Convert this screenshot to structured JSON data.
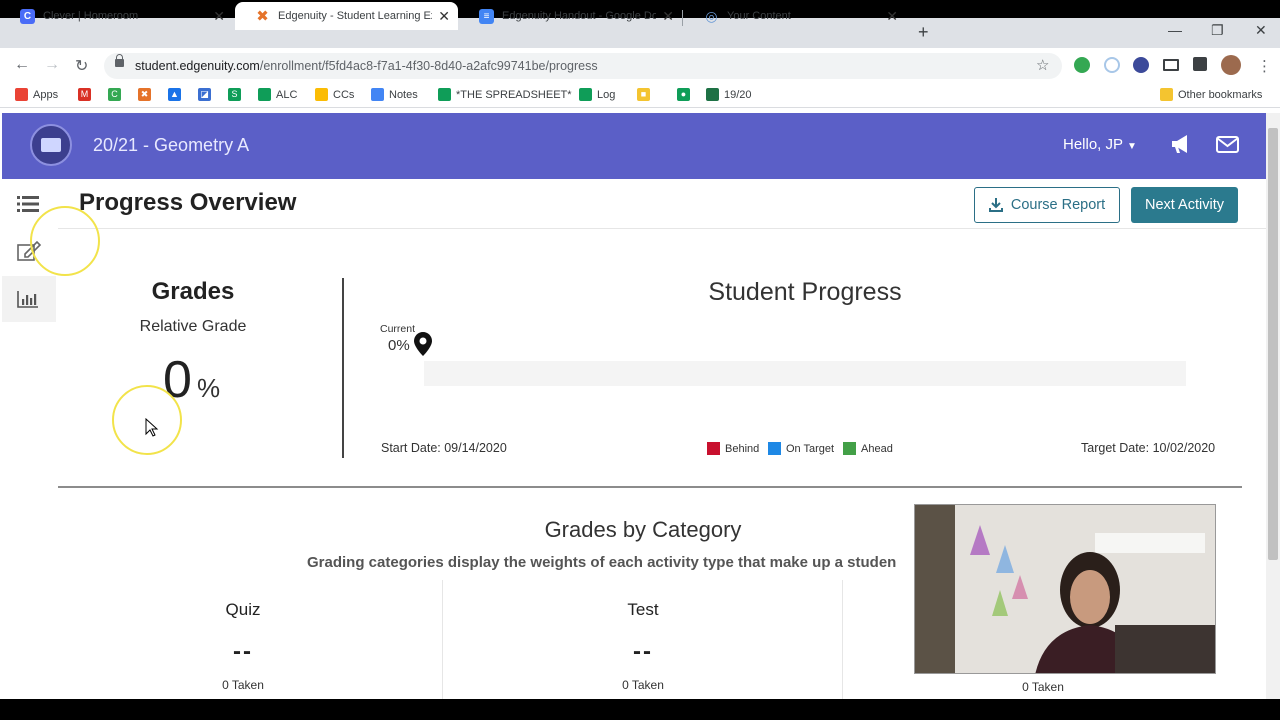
{
  "browser": {
    "tabs": [
      {
        "title": "Clever | Homeroom",
        "favicon_color": "#4a6cf7",
        "favicon_glyph": "C"
      },
      {
        "title": "Edgenuity - Student Learning Exp",
        "favicon_color": "#e5732a",
        "favicon_glyph": "✖"
      },
      {
        "title": "Edgenuity Handout - Google Do",
        "favicon_color": "#4285f4",
        "favicon_glyph": "≡"
      },
      {
        "title": "Your Content",
        "favicon_color": "#9fb8d9",
        "favicon_glyph": "◎"
      }
    ],
    "new_tab_label": "+",
    "close_glyph": "✕",
    "url_host": "student.edgenuity.com",
    "url_path": "/enrollment/f5fd4ac8-f7a1-4f30-8d40-a2afc99741be/progress",
    "bookmarks": [
      {
        "label": "Apps",
        "color": "#ea4335"
      },
      {
        "label": "",
        "color": "#d93025",
        "glyph": "M"
      },
      {
        "label": "",
        "color": "#34a853",
        "glyph": "C"
      },
      {
        "label": "",
        "color": "#e5732a",
        "glyph": "✖"
      },
      {
        "label": "",
        "color": "#1a73e8",
        "glyph": "▲"
      },
      {
        "label": "",
        "color": "#3b6fd1",
        "glyph": "◪"
      },
      {
        "label": "",
        "color": "#0f9d58",
        "glyph": "S"
      },
      {
        "label": "ALC",
        "color": "#0f9d58"
      },
      {
        "label": "CCs",
        "color": "#fbbc04"
      },
      {
        "label": "Notes",
        "color": "#4285f4"
      },
      {
        "label": "*THE SPREADSHEET*",
        "color": "#0f9d58"
      },
      {
        "label": "Log",
        "color": "#0f9d58"
      },
      {
        "label": "",
        "color": "#f4c430",
        "glyph": "■"
      },
      {
        "label": "",
        "color": "#0f9d58",
        "glyph": "●"
      },
      {
        "label": "19/20",
        "color": "#1e7145"
      }
    ],
    "other_bookmarks": "Other bookmarks"
  },
  "app": {
    "course_title": "20/21 - Geometry A",
    "greeting": "Hello, JP",
    "header_color": "#5b5fc7",
    "accent": "#2b7a8e"
  },
  "page": {
    "title": "Progress Overview",
    "course_report_label": "Course Report",
    "next_activity_label": "Next Activity"
  },
  "grades": {
    "heading": "Grades",
    "relative_label": "Relative Grade",
    "value": "0",
    "unit": "%"
  },
  "progress": {
    "title": "Student Progress",
    "current_label": "Current",
    "current_value": "0%",
    "current_fraction": 0,
    "start_date": "Start Date: 09/14/2020",
    "target_date": "Target Date: 10/02/2020",
    "legend": [
      {
        "label": "Behind",
        "color": "#c8102e"
      },
      {
        "label": "On Target",
        "color": "#1e88e5"
      },
      {
        "label": "Ahead",
        "color": "#43a047"
      }
    ]
  },
  "categories": {
    "title": "Grades by Category",
    "subtitle": "Grading categories display the weights of each activity type that make up a studen",
    "items": [
      {
        "name": "Quiz",
        "value": "--",
        "taken": "0 Taken"
      },
      {
        "name": "Test",
        "value": "--",
        "taken": "0 Taken"
      },
      {
        "name": "",
        "value": "",
        "taken": "0 Taken"
      }
    ]
  }
}
